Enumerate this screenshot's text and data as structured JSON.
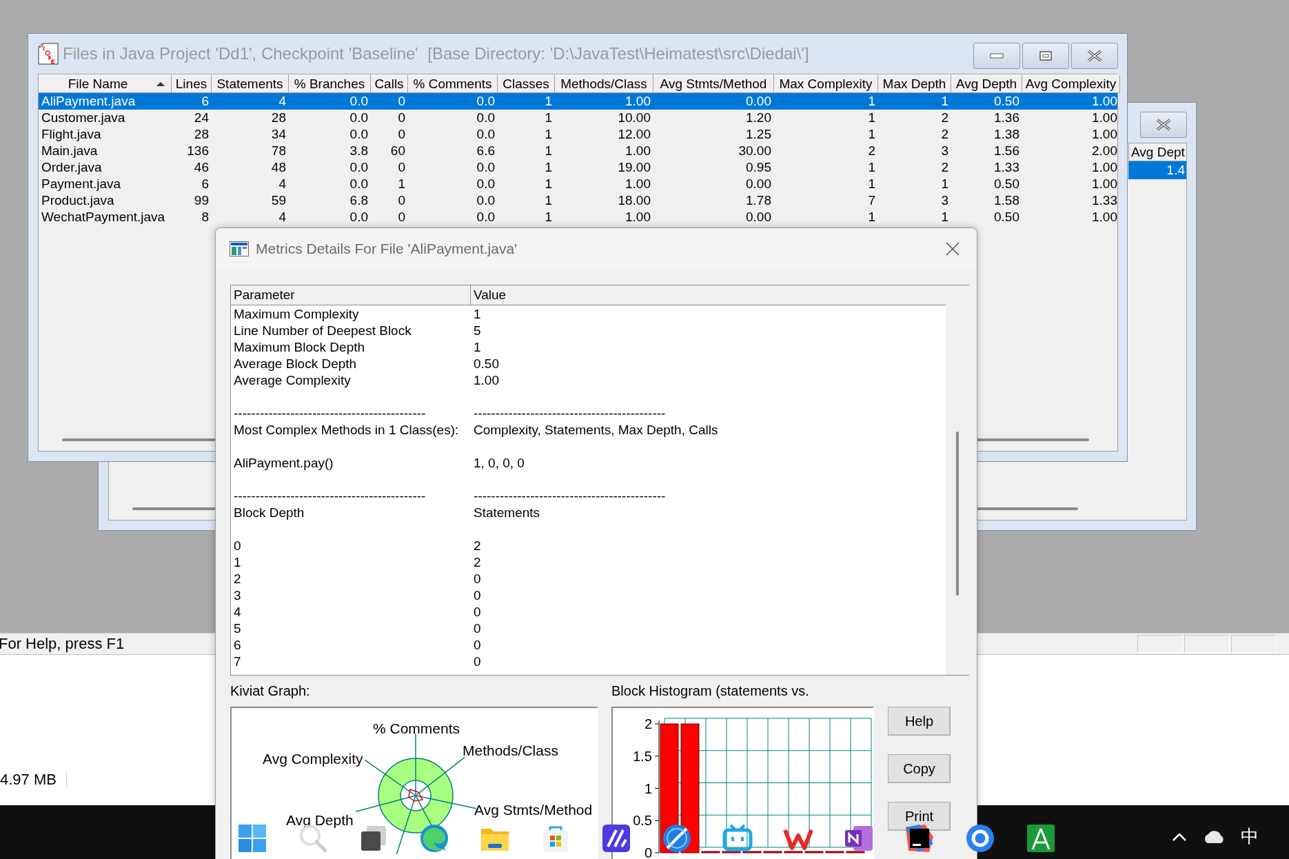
{
  "back_window": {
    "column": "Avg Dept",
    "rows": [
      {
        "value": "1.4",
        "selected": true
      }
    ]
  },
  "main_window": {
    "title": "Files in Java Project 'Dd1', Checkpoint 'Baseline'  [Base Directory: 'D:\\JavaTest\\Heimatest\\src\\Diedai\\']",
    "columns": [
      {
        "label": "File Name",
        "sorted": true
      },
      {
        "label": "Lines",
        "sorted": false
      },
      {
        "label": "Statements",
        "sorted": false
      },
      {
        "label": "% Branches",
        "sorted": false
      },
      {
        "label": "Calls",
        "sorted": false
      },
      {
        "label": "% Comments",
        "sorted": false
      },
      {
        "label": "Classes",
        "sorted": false
      },
      {
        "label": "Methods/Class",
        "sorted": false
      },
      {
        "label": "Avg Stmts/Method",
        "sorted": false
      },
      {
        "label": "Max Complexity",
        "sorted": false
      },
      {
        "label": "Max Depth",
        "sorted": false
      },
      {
        "label": "Avg Depth",
        "sorted": false
      },
      {
        "label": "Avg Complexity",
        "sorted": false
      }
    ],
    "rows": [
      {
        "selected": true,
        "cells": [
          "AliPayment.java",
          "6",
          "4",
          "0.0",
          "0",
          "0.0",
          "1",
          "1.00",
          "0.00",
          "1",
          "1",
          "0.50",
          "1.00"
        ]
      },
      {
        "selected": false,
        "cells": [
          "Customer.java",
          "24",
          "28",
          "0.0",
          "0",
          "0.0",
          "1",
          "10.00",
          "1.20",
          "1",
          "2",
          "1.36",
          "1.00"
        ]
      },
      {
        "selected": false,
        "cells": [
          "Flight.java",
          "28",
          "34",
          "0.0",
          "0",
          "0.0",
          "1",
          "12.00",
          "1.25",
          "1",
          "2",
          "1.38",
          "1.00"
        ]
      },
      {
        "selected": false,
        "cells": [
          "Main.java",
          "136",
          "78",
          "3.8",
          "60",
          "6.6",
          "1",
          "1.00",
          "30.00",
          "2",
          "3",
          "1.56",
          "2.00"
        ]
      },
      {
        "selected": false,
        "cells": [
          "Order.java",
          "46",
          "48",
          "0.0",
          "0",
          "0.0",
          "1",
          "19.00",
          "0.95",
          "1",
          "2",
          "1.33",
          "1.00"
        ]
      },
      {
        "selected": false,
        "cells": [
          "Payment.java",
          "6",
          "4",
          "0.0",
          "1",
          "0.0",
          "1",
          "1.00",
          "0.00",
          "1",
          "1",
          "0.50",
          "1.00"
        ]
      },
      {
        "selected": false,
        "cells": [
          "Product.java",
          "99",
          "59",
          "6.8",
          "0",
          "0.0",
          "1",
          "18.00",
          "1.78",
          "7",
          "3",
          "1.58",
          "1.33"
        ]
      },
      {
        "selected": false,
        "cells": [
          "WechatPayment.java",
          "8",
          "4",
          "0.0",
          "0",
          "0.0",
          "1",
          "1.00",
          "0.00",
          "1",
          "1",
          "0.50",
          "1.00"
        ]
      }
    ]
  },
  "status_bar": {
    "text": "For Help, press F1"
  },
  "memory": "4.97 MB",
  "dialog": {
    "title": "Metrics Details For File 'AliPayment.java'",
    "columns": [
      "Parameter",
      "Value"
    ],
    "rows": [
      {
        "kind": "text",
        "parameter": "Maximum Complexity",
        "value": "1"
      },
      {
        "kind": "text",
        "parameter": "Line Number of Deepest Block",
        "value": "5"
      },
      {
        "kind": "text",
        "parameter": "Maximum Block Depth",
        "value": "1"
      },
      {
        "kind": "text",
        "parameter": "Average Block Depth",
        "value": "0.50"
      },
      {
        "kind": "text",
        "parameter": "Average Complexity",
        "value": "1.00"
      },
      {
        "kind": "gap"
      },
      {
        "kind": "text",
        "parameter": "--------------------------------------------",
        "value": "--------------------------------------------"
      },
      {
        "kind": "text",
        "parameter": "Most Complex Methods in 1 Class(es):",
        "value": "Complexity, Statements, Max Depth, Calls"
      },
      {
        "kind": "gap"
      },
      {
        "kind": "text",
        "parameter": "AliPayment.pay()",
        "value": "1, 0, 0, 0"
      },
      {
        "kind": "gap"
      },
      {
        "kind": "text",
        "parameter": "--------------------------------------------",
        "value": "--------------------------------------------"
      },
      {
        "kind": "text",
        "parameter": "Block Depth",
        "value": "Statements"
      },
      {
        "kind": "gap"
      },
      {
        "kind": "text",
        "parameter": "0",
        "value": "2"
      },
      {
        "kind": "text",
        "parameter": "1",
        "value": "2"
      },
      {
        "kind": "text",
        "parameter": "2",
        "value": "0"
      },
      {
        "kind": "text",
        "parameter": "3",
        "value": "0"
      },
      {
        "kind": "text",
        "parameter": "4",
        "value": "0"
      },
      {
        "kind": "text",
        "parameter": "5",
        "value": "0"
      },
      {
        "kind": "text",
        "parameter": "6",
        "value": "0"
      },
      {
        "kind": "text",
        "parameter": "7",
        "value": "0"
      }
    ],
    "kiviat": {
      "title": "Kiviat Graph:",
      "axes": [
        "% Comments",
        "Methods/Class",
        "Avg Stmts/Method",
        "Avg Depth",
        "Avg Complexity"
      ]
    },
    "histogram": {
      "chart_data": {
        "type": "bar",
        "title": "Block Histogram (statements vs.",
        "values": [
          2,
          2,
          0,
          0,
          0,
          0,
          0,
          0,
          0,
          0
        ],
        "ylim": [
          0,
          2
        ],
        "yticks": [
          0,
          0.5,
          1,
          1.5,
          2
        ]
      }
    },
    "buttons": [
      "Help",
      "Copy",
      "Print"
    ]
  },
  "taskbar": {
    "apps": [
      {
        "kind": "grid"
      },
      {
        "kind": "magnifier"
      },
      {
        "kind": "squares"
      },
      {
        "kind": "swirl"
      },
      {
        "kind": "folder"
      },
      {
        "kind": "bag"
      },
      {
        "kind": "slash"
      },
      {
        "kind": "compass"
      },
      {
        "kind": "tv"
      },
      {
        "kind": "zigzag"
      },
      {
        "kind": "notebook"
      },
      {
        "kind": "dark-tile"
      },
      {
        "kind": "ring"
      },
      {
        "kind": "green-tile"
      }
    ],
    "ime": "中"
  }
}
